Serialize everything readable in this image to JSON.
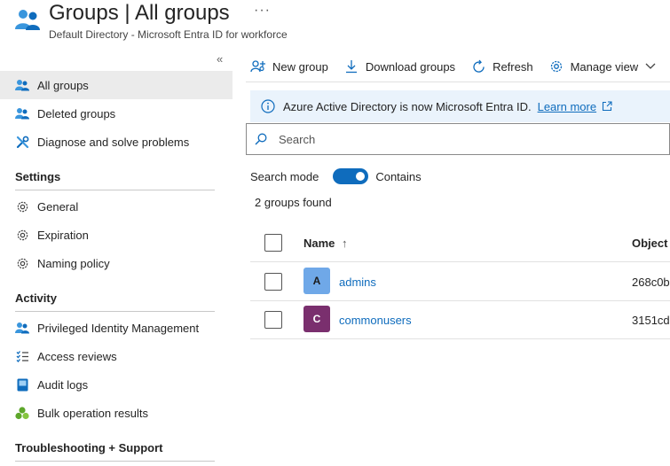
{
  "header": {
    "title": "Groups | All groups",
    "more": "···",
    "subtitle": "Default Directory - Microsoft Entra ID for workforce"
  },
  "sidebar": {
    "collapse": "«",
    "items": [
      {
        "label": "All groups",
        "icon": "groups-icon"
      },
      {
        "label": "Deleted groups",
        "icon": "groups-icon"
      },
      {
        "label": "Diagnose and solve problems",
        "icon": "wrench-icon"
      }
    ],
    "settings": {
      "heading": "Settings",
      "items": [
        {
          "label": "General",
          "icon": "gear-icon"
        },
        {
          "label": "Expiration",
          "icon": "gear-icon"
        },
        {
          "label": "Naming policy",
          "icon": "gear-icon"
        }
      ]
    },
    "activity": {
      "heading": "Activity",
      "items": [
        {
          "label": "Privileged Identity Management",
          "icon": "groups-icon"
        },
        {
          "label": "Access reviews",
          "icon": "checklist-icon"
        },
        {
          "label": "Audit logs",
          "icon": "log-icon"
        },
        {
          "label": "Bulk operation results",
          "icon": "bulk-icon"
        }
      ]
    },
    "troubleshooting": {
      "heading": "Troubleshooting + Support"
    }
  },
  "toolbar": {
    "new_group": "New group",
    "download_groups": "Download groups",
    "refresh": "Refresh",
    "manage_view": "Manage view"
  },
  "banner": {
    "text": "Azure Active Directory is now Microsoft Entra ID.",
    "link": "Learn more"
  },
  "search": {
    "placeholder": "Search",
    "value": ""
  },
  "search_mode": {
    "label": "Search mode",
    "value": "Contains",
    "enabled": true
  },
  "results": {
    "count": "2 groups found"
  },
  "table": {
    "columns": {
      "name": "Name",
      "sort": "↑",
      "object": "Object"
    },
    "rows": [
      {
        "initial": "A",
        "name": "admins",
        "object_id": "268c0b",
        "color": "#6fa8e8"
      },
      {
        "initial": "C",
        "name": "commonusers",
        "object_id": "3151cd",
        "color": "#7a2f6e"
      }
    ]
  },
  "colors": {
    "accent": "#0f6cbd",
    "banner_bg": "#eaf3fc",
    "active_nav": "#ebebeb"
  }
}
